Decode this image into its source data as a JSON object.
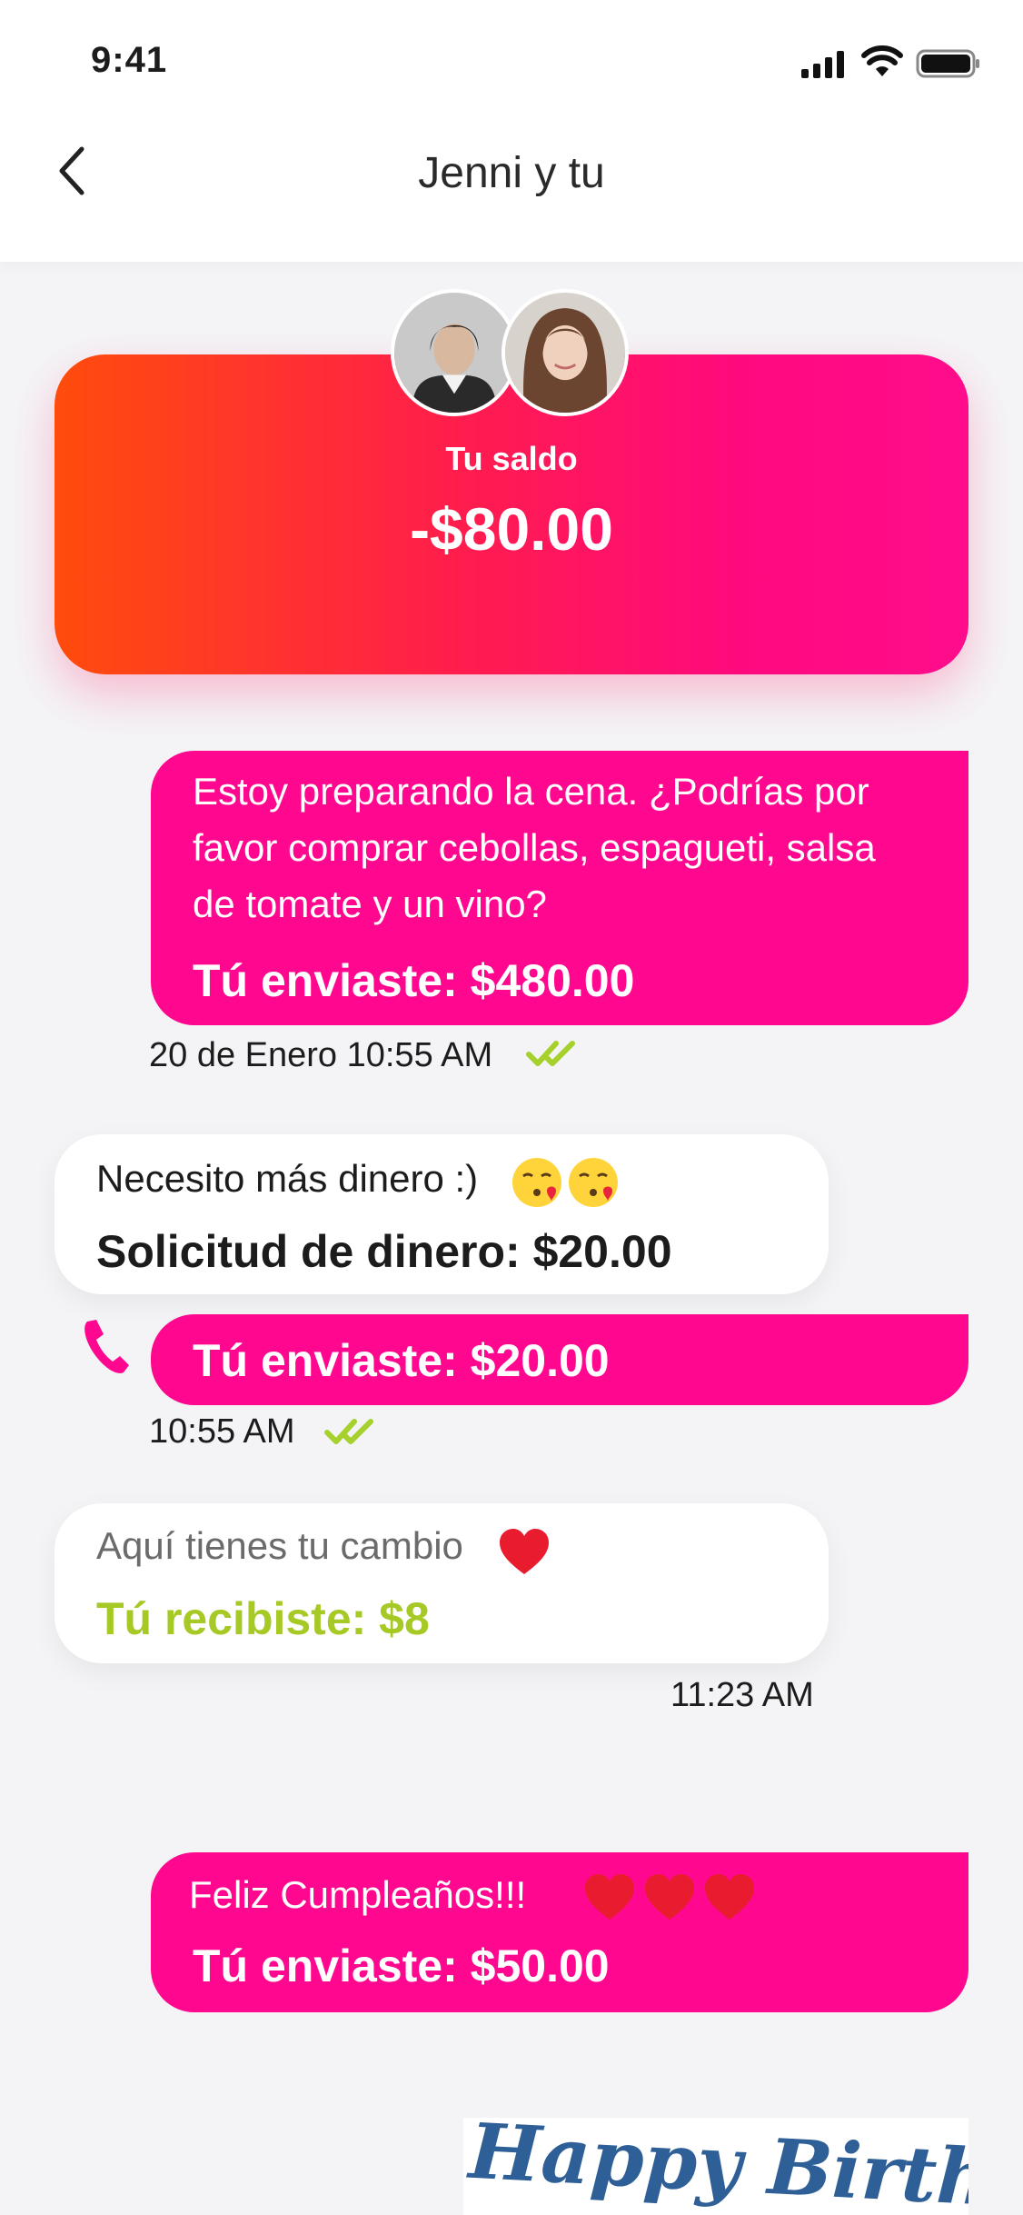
{
  "status_bar": {
    "time": "9:41"
  },
  "header": {
    "title": "Jenni y tu"
  },
  "balance": {
    "label": "Tu saldo",
    "amount": "-$80.00"
  },
  "messages": [
    {
      "text": "Estoy preparando la cena. ¿Podrías por favor comprar cebollas, espagueti, salsa de tomate y un vino?",
      "amount": "Tú enviaste: $480.00",
      "meta": "20 de Enero 10:55 AM"
    },
    {
      "text": "Necesito más dinero :)",
      "amount": "Solicitud de dinero: $20.00"
    },
    {
      "amount": "Tú enviaste: $20.00",
      "meta": "10:55 AM"
    },
    {
      "text": "Aquí tienes tu cambio",
      "amount": "Tú recibiste: $8",
      "meta": "11:23 AM"
    },
    {
      "text": "Feliz Cumpleaños!!!",
      "amount": "Tú enviaste: $50.00"
    }
  ],
  "card": {
    "text": "Happy Birthday"
  },
  "colors": {
    "accent_pink": "#ff078f",
    "accent_orange": "#ff4c0c",
    "received_green": "#a6c925",
    "check_green": "#a6d12c",
    "card_blue": "#2f5f97"
  },
  "icons": [
    "back-chevron-icon",
    "signal-icon",
    "wifi-icon",
    "battery-icon",
    "double-check-icon",
    "kiss-emoji-icon",
    "heart-emoji-icon",
    "phone-icon"
  ]
}
